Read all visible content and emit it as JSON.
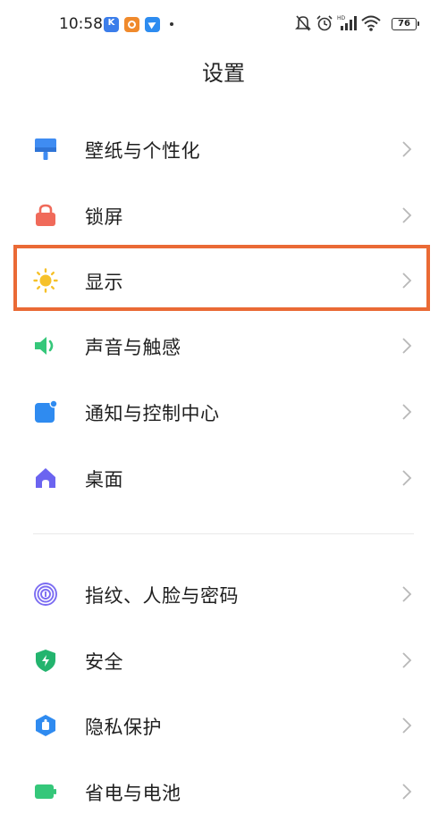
{
  "status_bar": {
    "time": "10:58",
    "battery": "76",
    "notification_icons": [
      "k-app-icon",
      "orange-app-icon",
      "blue-send-icon"
    ],
    "system_icons": [
      "mute-icon",
      "alarm-icon",
      "hd-signal-icon",
      "wifi-icon",
      "battery-icon"
    ]
  },
  "header": {
    "title": "设置"
  },
  "settings_group_1": [
    {
      "label": "壁纸与个性化",
      "icon": "wallpaper-icon",
      "color": "#3f8cf2"
    },
    {
      "label": "锁屏",
      "icon": "lock-icon",
      "color": "#f06a5a"
    },
    {
      "label": "显示",
      "icon": "sun-icon",
      "color": "#f6c12a"
    },
    {
      "label": "声音与触感",
      "icon": "speaker-icon",
      "color": "#35c77a"
    },
    {
      "label": "通知与控制中心",
      "icon": "notification-icon",
      "color": "#2f8bf0"
    },
    {
      "label": "桌面",
      "icon": "home-icon",
      "color": "#6b64f0"
    }
  ],
  "settings_group_2": [
    {
      "label": "指纹、人脸与密码",
      "icon": "fingerprint-icon",
      "color": "#7b6cf2"
    },
    {
      "label": "安全",
      "icon": "shield-icon",
      "color": "#23b46e"
    },
    {
      "label": "隐私保护",
      "icon": "privacy-icon",
      "color": "#2f8bf0"
    },
    {
      "label": "省电与电池",
      "icon": "battery-saver-icon",
      "color": "#35c77a"
    }
  ],
  "highlight_color": "#ea6a35"
}
